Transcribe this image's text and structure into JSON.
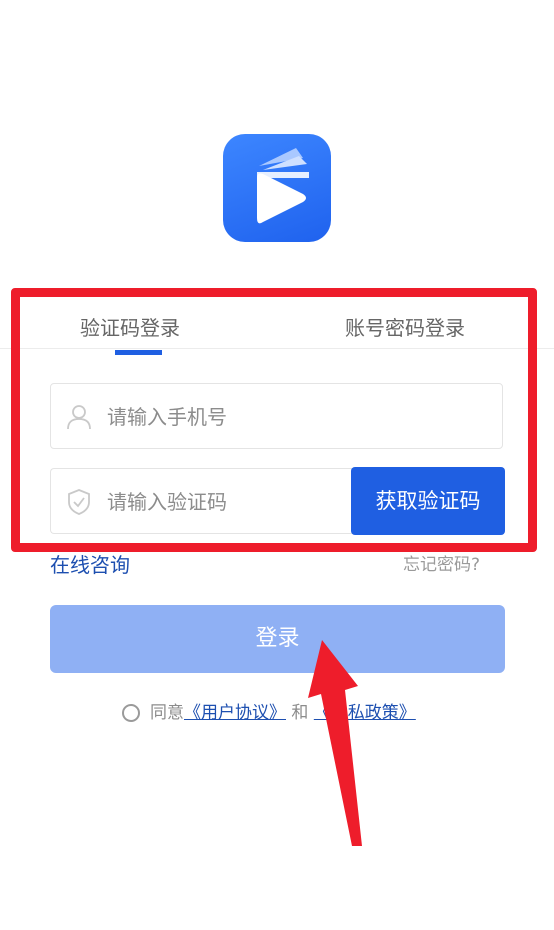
{
  "tabs": {
    "sms_login": "验证码登录",
    "password_login": "账号密码登录"
  },
  "form": {
    "phone_placeholder": "请输入手机号",
    "code_placeholder": "请输入验证码",
    "get_code_label": "获取验证码"
  },
  "links": {
    "online_consult": "在线咨询",
    "forgot_password": "忘记密码?"
  },
  "login_label": "登录",
  "agreement": {
    "prefix": "同意",
    "user_agreement": "《用户协议》",
    "conjunction": "和",
    "privacy_policy": "《隐私政策》"
  },
  "colors": {
    "brand": "#1f5fe2",
    "login_disabled": "#8fb0f4",
    "annotation_red": "#ee1d2b"
  }
}
